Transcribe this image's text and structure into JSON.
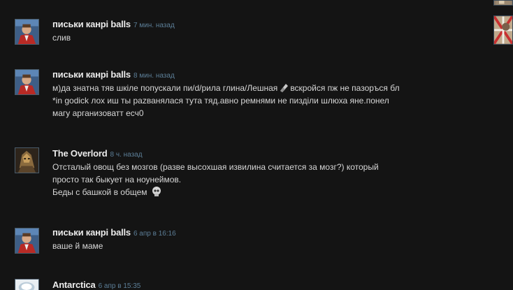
{
  "comments": [
    {
      "author": "письки канрі balls",
      "time": "7 мин. назад",
      "lines": [
        "слив"
      ],
      "avatar": "portrait-avatar-red-jacket"
    },
    {
      "author": "письки канрі balls",
      "time": "8 мин. назад",
      "lines": [
        "м)да знатна тяв шкіле попускали пи/d/рила глина/Лешная",
        "вскройся пж не пазоръся бл",
        "*in godick лох иш ты раzванялася тута тяд.авно ремнями не пизділи шлюха яне.понел",
        "магу арганизоватт есч0"
      ],
      "avatar": "portrait-avatar-red-jacket"
    },
    {
      "author": "The Overlord",
      "time": "8 ч. назад",
      "lines": [
        "Отсталый овощ без мозгов (разве высохшая извилина считается за мозг?) который",
        "просто так быкует на ноунеймов.",
        "Беды с башкой в общем"
      ],
      "avatar": "armored-warrior-avatar"
    },
    {
      "author": "письки канрі balls",
      "time": "6 апр в 16:16",
      "lines": [
        "ваше й маме"
      ],
      "avatar": "portrait-avatar-red-jacket"
    },
    {
      "author": "Antarctica",
      "time": "6 апр в 15:35",
      "lines": [],
      "avatar": "white-globe-avatar"
    }
  ],
  "colors": {
    "background": "#141414",
    "author": "#ebebeb",
    "timestamp": "#5c7e97",
    "text": "#d7d7d7"
  }
}
